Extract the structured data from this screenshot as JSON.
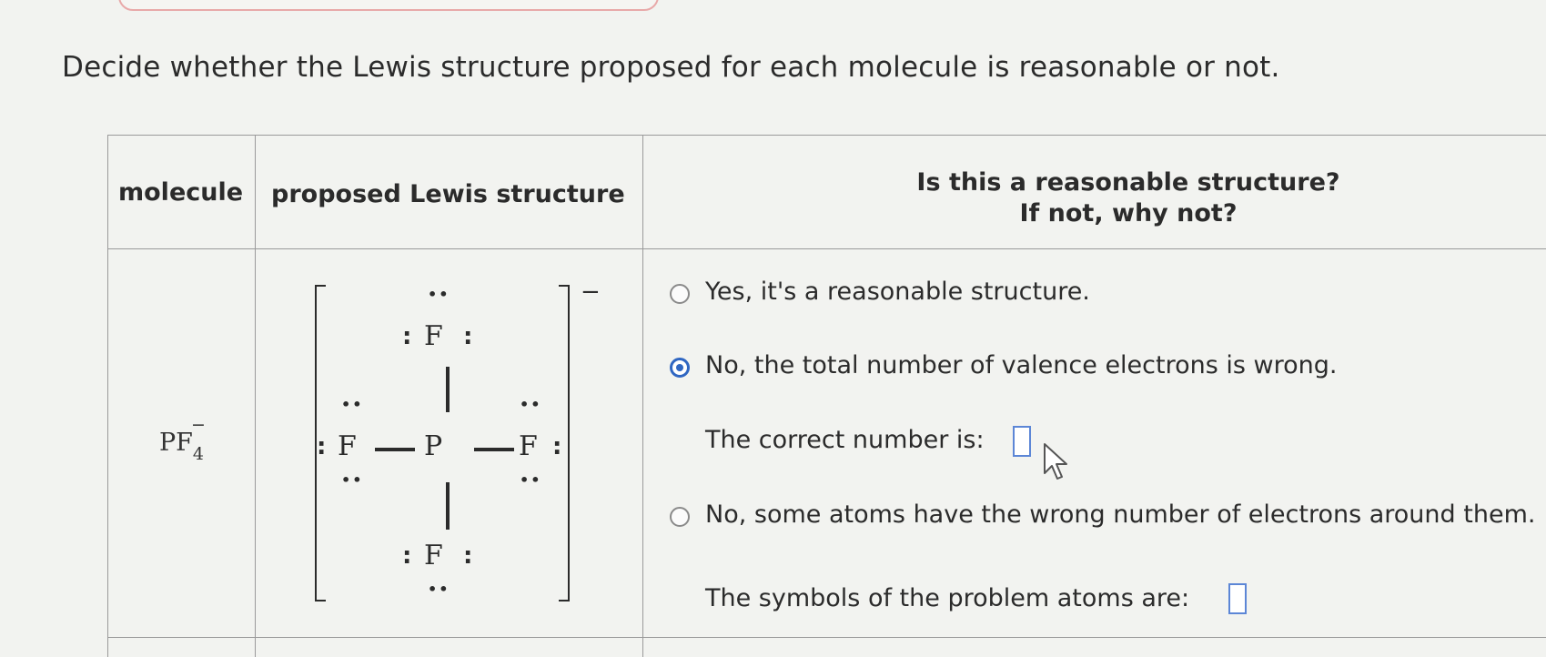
{
  "prompt": "Decide whether the Lewis structure proposed for each molecule is reasonable or not.",
  "table": {
    "headers": {
      "molecule": "molecule",
      "structure": "proposed Lewis structure",
      "question_line1": "Is this a reasonable structure?",
      "question_line2": "If not, why not?"
    },
    "row": {
      "formula": {
        "base": "PF",
        "subscript": "4",
        "charge": "−"
      },
      "lewis": {
        "central_atom": "P",
        "ligand_atom": "F",
        "overall_charge": "−",
        "lone_pair": "••",
        "colon": ":"
      },
      "options": [
        {
          "label": "Yes, it's a reasonable structure.",
          "selected": false
        },
        {
          "label": "No, the total number of valence electrons is wrong.",
          "selected": true
        },
        {
          "label": "No, some atoms have the wrong number of electrons around them.",
          "selected": false
        }
      ],
      "correct_number_label": "The correct number is:",
      "correct_number_value": "",
      "problem_atoms_label": "The symbols of the problem atoms are:",
      "problem_atoms_value": ""
    }
  },
  "colors": {
    "accent": "#2f66c2",
    "grid": "#9a9a9a",
    "background": "#f2f3f0"
  },
  "icons": [
    "radio-unselected-icon",
    "radio-selected-icon",
    "mouse-pointer-icon"
  ]
}
